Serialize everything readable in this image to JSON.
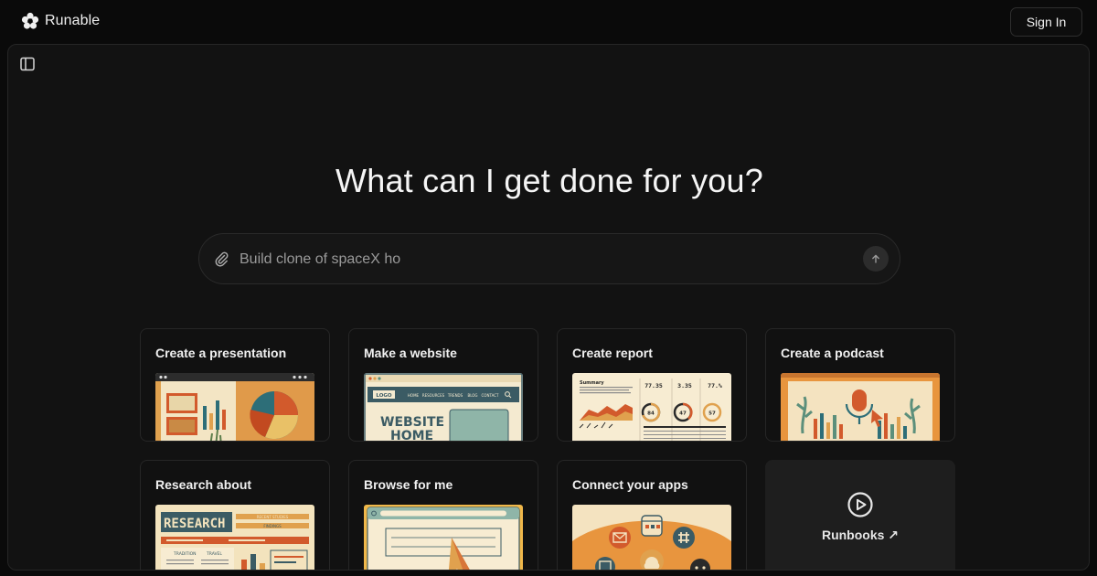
{
  "app": {
    "name": "Runable"
  },
  "header": {
    "signin_label": "Sign In"
  },
  "main": {
    "headline": "What can I get done for you?",
    "prompt": {
      "value": "Build clone of spaceX ho"
    }
  },
  "cards": [
    {
      "label": "Create a presentation"
    },
    {
      "label": "Make a website",
      "thumb_text": {
        "logo": "LOGO",
        "nav": [
          "HOME",
          "RESOURCES",
          "TRENDS",
          "BLOG",
          "CONTACT"
        ],
        "hero_line1": "WEBSITE",
        "hero_line2": "HOME"
      }
    },
    {
      "label": "Create report",
      "thumb_text": {
        "summary": "Summary",
        "stats": [
          "77.35",
          "3.35",
          "77.%"
        ],
        "rings": [
          "84",
          "47",
          "57"
        ]
      }
    },
    {
      "label": "Create a podcast"
    },
    {
      "label": "Research about",
      "thumb_text": {
        "title": "RESEARCH",
        "tags": [
          "RECENT STUDIES",
          "FINDINGS"
        ],
        "cols": [
          "TRADITION",
          "TRAVEL"
        ]
      }
    },
    {
      "label": "Browse for me"
    },
    {
      "label": "Connect your apps"
    }
  ],
  "runbooks": {
    "label": "Runbooks ↗"
  },
  "icons": {
    "logo": "logo-icon",
    "sidebar": "sidebar-toggle-icon",
    "attach": "paperclip-icon",
    "send": "arrow-up-icon",
    "play": "play-circle-icon"
  },
  "colors": {
    "background": "#0a0a0a",
    "panel": "#121212",
    "card_border": "#262626",
    "runbooks_bg": "#1e1e1e"
  }
}
